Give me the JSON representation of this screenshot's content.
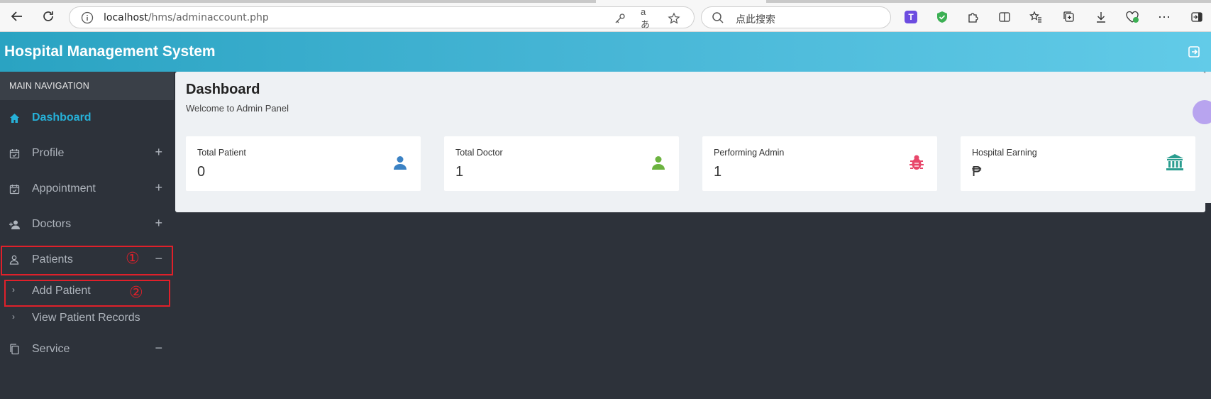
{
  "browser": {
    "url_host": "localhost",
    "url_path": "/hms/adminaccount.php",
    "search_placeholder": "点此搜索"
  },
  "header": {
    "title": "Hospital Management System"
  },
  "sidebar": {
    "section_title": "MAIN NAVIGATION",
    "items": [
      {
        "label": "Dashboard",
        "icon": "home-icon",
        "toggle": ""
      },
      {
        "label": "Profile",
        "icon": "calendar-check-icon",
        "toggle": "+"
      },
      {
        "label": "Appointment",
        "icon": "calendar-check-icon",
        "toggle": "+"
      },
      {
        "label": "Doctors",
        "icon": "user-plus-icon",
        "toggle": "+"
      },
      {
        "label": "Patients",
        "icon": "user-icon",
        "toggle": "−"
      },
      {
        "label": "Service",
        "icon": "copy-icon",
        "toggle": "−"
      }
    ],
    "patient_subitems": [
      "Add Patient",
      "View Patient Records"
    ]
  },
  "annotations": {
    "one": "①",
    "two": "②"
  },
  "dashboard": {
    "title": "Dashboard",
    "subtitle": "Welcome to Admin Panel",
    "cards": [
      {
        "label": "Total Patient",
        "value": "0",
        "icon": "user-icon",
        "color": "#3b82c4"
      },
      {
        "label": "Total Doctor",
        "value": "1",
        "icon": "user-icon",
        "color": "#6cb33f"
      },
      {
        "label": "Performing Admin",
        "value": "1",
        "icon": "bug-icon",
        "color": "#e8466a"
      },
      {
        "label": "Hospital Earning",
        "value": "₱",
        "icon": "bank-icon",
        "color": "#2a9d8f"
      }
    ]
  },
  "colors": {
    "accent": "#26b1d8",
    "sidebar_bg": "#2d323a",
    "annotation_red": "#e0202a"
  }
}
